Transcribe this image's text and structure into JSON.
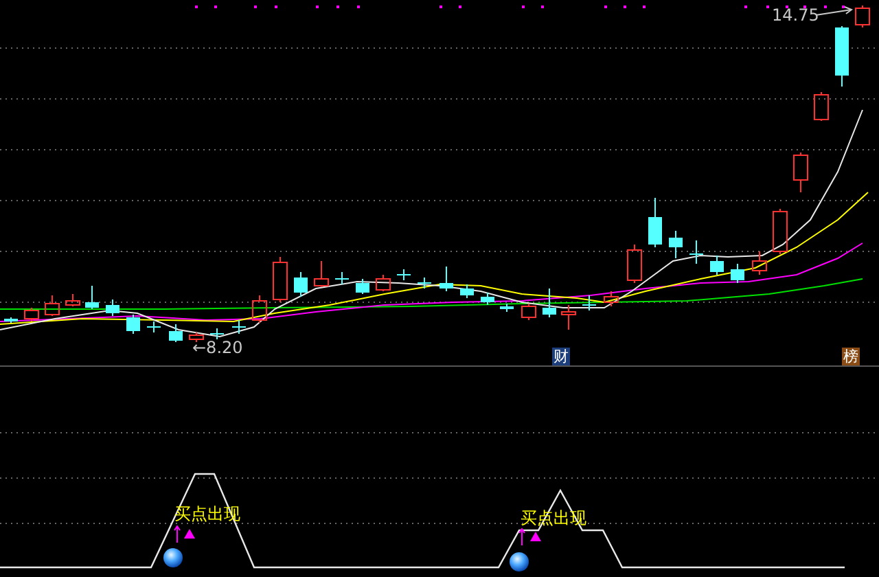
{
  "price_chart": {
    "high_label": "14.75",
    "low_label": "←8.20",
    "markers": [
      {
        "text": "财",
        "color": "#1c3f7c"
      },
      {
        "text": "榜",
        "color": "#8a4c14"
      }
    ]
  },
  "signal_panel": {
    "signals": [
      {
        "text": "买点出现"
      },
      {
        "text": "买点出现"
      }
    ]
  }
}
